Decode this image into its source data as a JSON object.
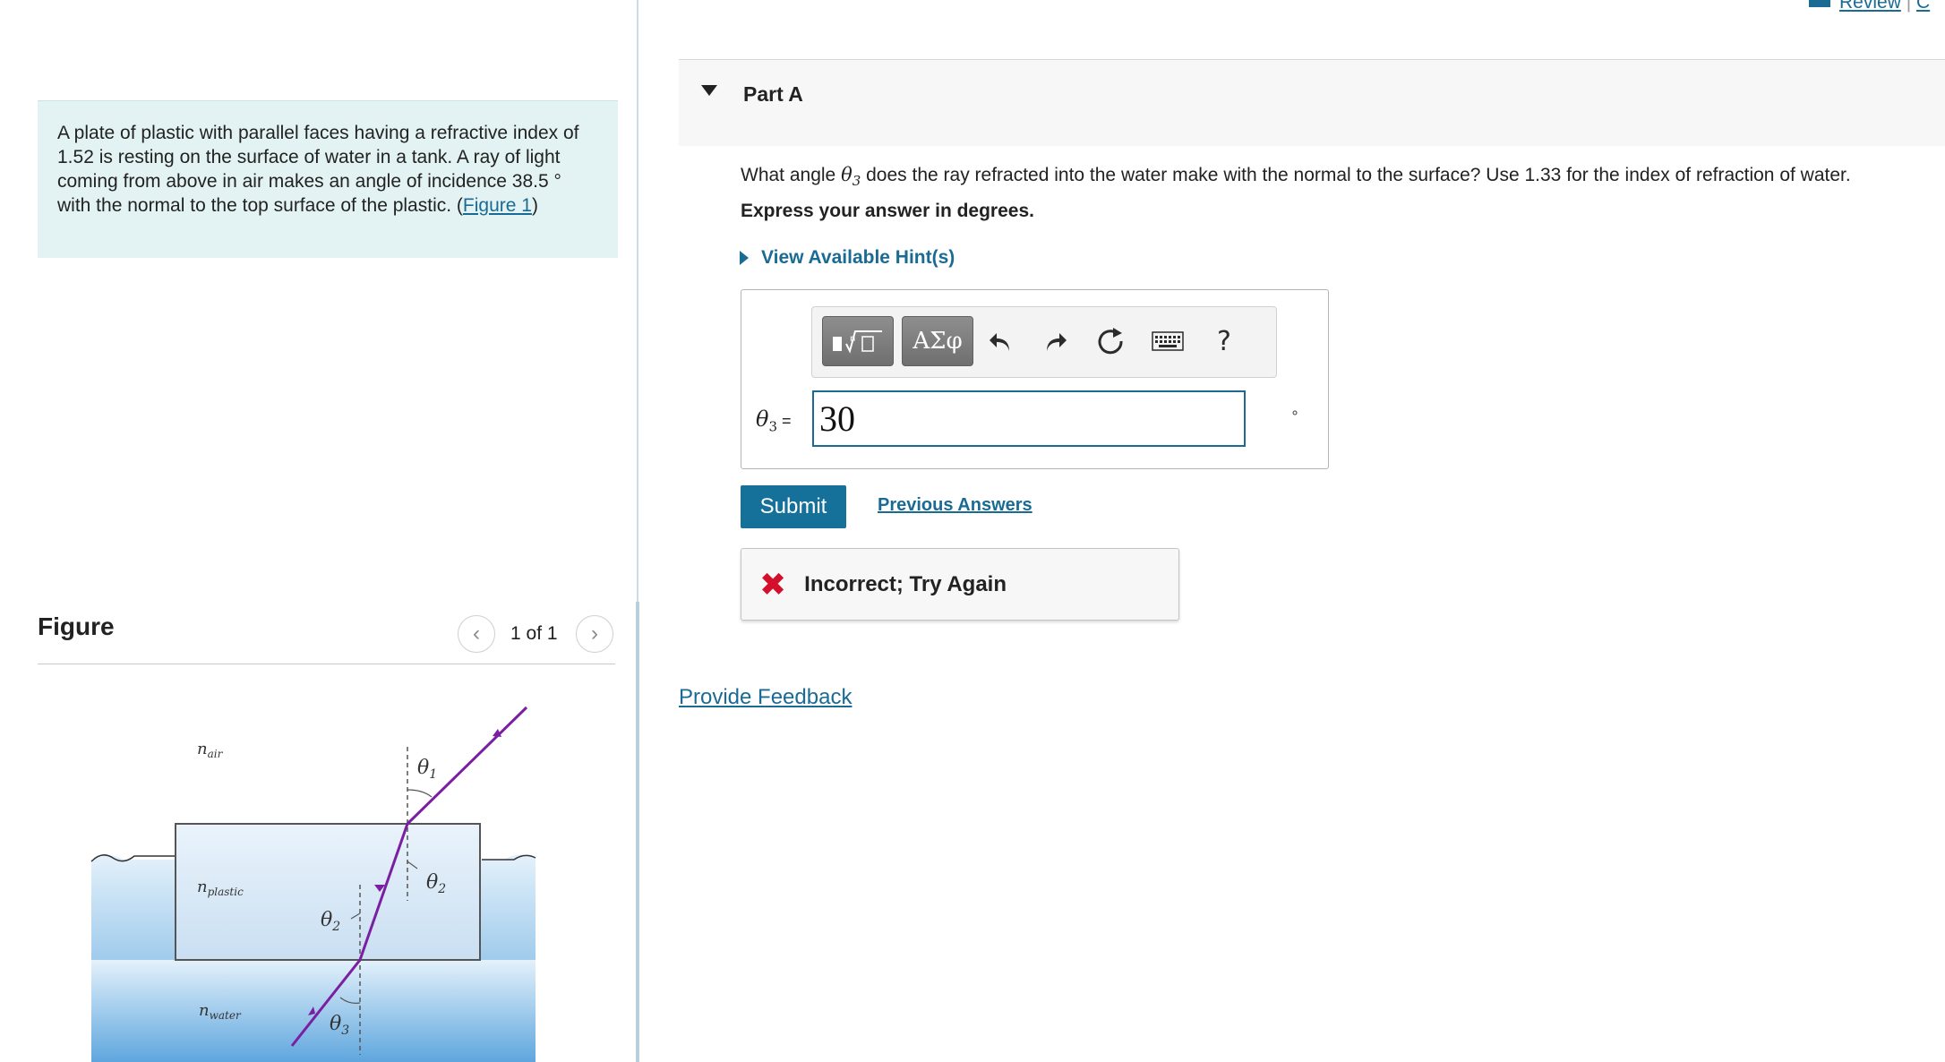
{
  "header": {
    "review_label": "Review",
    "separator": "|",
    "constants_label": "C"
  },
  "problem": {
    "text": "A plate of plastic with parallel faces having a refractive index of 1.52 is resting on the surface of water in a tank. A ray of light coming from above in air makes an angle of incidence 38.5 ° with the normal to the top surface of the plastic. (",
    "figure_link": "Figure 1",
    "text_end": ")"
  },
  "figure_panel": {
    "heading": "Figure",
    "counter": "1 of 1",
    "prev_icon": "chevron-left-icon",
    "next_icon": "chevron-right-icon",
    "labels": {
      "n_air": "n",
      "n_air_sub": "air",
      "n_plastic": "n",
      "n_plastic_sub": "plastic",
      "n_water": "n",
      "n_water_sub": "water",
      "theta1": "θ",
      "theta1_sub": "1",
      "theta2_a": "θ",
      "theta2_a_sub": "2",
      "theta2_b": "θ",
      "theta2_b_sub": "2",
      "theta3": "θ",
      "theta3_sub": "3"
    },
    "colors": {
      "ray": "#7a1fa2",
      "water_top": "#dcecf8",
      "water_bottom": "#6aaee0",
      "plastic": "#dbeaf6"
    }
  },
  "part": {
    "title": "Part A",
    "question_pre": "What angle ",
    "question_symbol": "θ",
    "question_symbol_sub": "3",
    "question_post": " does the ray refracted into the water make with the normal to the surface? Use 1.33 for the index of refraction of water.",
    "instruction": "Express your answer in degrees.",
    "hints_label": "View Available Hint(s)"
  },
  "answer": {
    "toolbar": {
      "templates_icon": "templates-icon",
      "greek_label": "ΑΣφ",
      "undo_icon": "undo-icon",
      "redo_icon": "redo-icon",
      "reset_icon": "reset-icon",
      "keyboard_icon": "keyboard-icon",
      "help_label": "?"
    },
    "label_symbol": "θ",
    "label_sub": "3",
    "label_eq": " =",
    "value": "30",
    "unit": "∘"
  },
  "actions": {
    "submit_label": "Submit",
    "previous_answers_label": "Previous Answers"
  },
  "feedback": {
    "icon": "x-icon",
    "status": "Incorrect; Try Again",
    "status_color": "#d40f2c"
  },
  "footer": {
    "provide_feedback_label": "Provide Feedback"
  }
}
